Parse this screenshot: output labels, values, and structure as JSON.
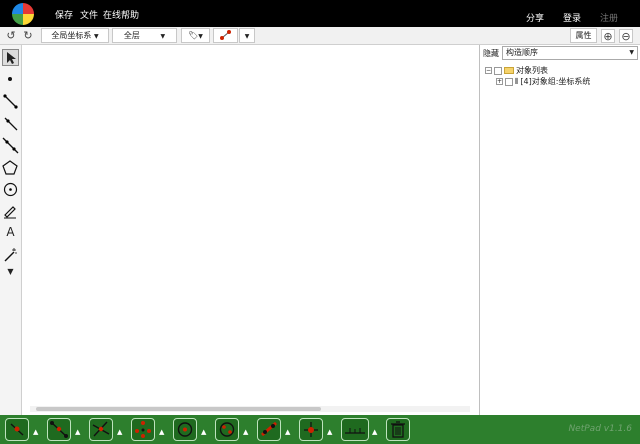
{
  "topbar": {
    "menu": [
      "保存",
      "文件",
      "在线帮助"
    ],
    "share": "分享",
    "login": "登录",
    "register": "注册"
  },
  "toolbar": {
    "coord_system": "全局坐标系",
    "layer": "全层",
    "properties": "属性"
  },
  "panel": {
    "hide": "隐藏",
    "order": "构造顺序",
    "tree_root": "对象列表",
    "tree_child": "[4]对象组:坐标系统"
  },
  "bottom": {
    "brand": "NetPad v1.1.6"
  },
  "colors": {
    "topbar": "#000000",
    "bottom": "#2d7f2d",
    "accent_red": "#cc2200"
  }
}
